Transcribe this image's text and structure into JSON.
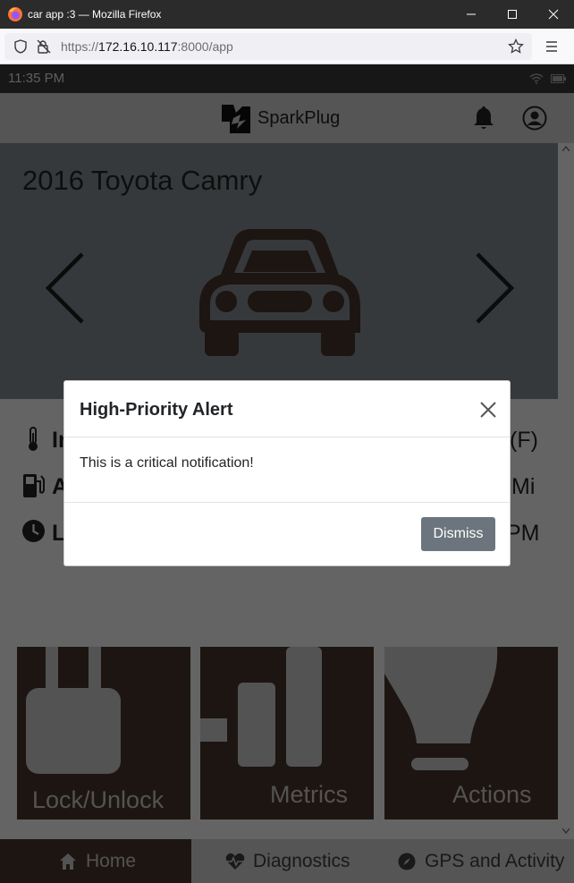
{
  "browser": {
    "window_title": "car app :3 — Mozilla Firefox",
    "url_prefix": "https://",
    "url_host": "172.16.10.117",
    "url_rest": ":8000/app"
  },
  "device_status": {
    "time": "11:35 PM"
  },
  "header": {
    "brand": "SparkPlug"
  },
  "vehicle": {
    "name": "2016 Toyota Camry"
  },
  "info_rows": [
    {
      "icon": "thermometer-icon",
      "left": "In",
      "right": "(F)"
    },
    {
      "icon": "fuel-pump-icon",
      "left": "A",
      "right": "Mi"
    },
    {
      "icon": "clock-icon",
      "left": "L",
      "right": "PM"
    }
  ],
  "tiles": [
    {
      "label": "Lock/Unlock",
      "icon": "lock-icon"
    },
    {
      "label": "Metrics",
      "icon": "bar-chart-icon"
    },
    {
      "label": "Actions",
      "icon": "lightbulb-icon"
    }
  ],
  "bottom_nav": [
    {
      "label": "Home",
      "icon": "home-icon",
      "active": true
    },
    {
      "label": "Diagnostics",
      "icon": "heartbeat-icon",
      "active": false
    },
    {
      "label": "GPS and Activity",
      "icon": "compass-icon",
      "active": false
    }
  ],
  "modal": {
    "title": "High-Priority Alert",
    "body": "This is a critical notification!",
    "dismiss_label": "Dismiss"
  },
  "colors": {
    "brand_brown": "#3a2b22",
    "hero_bg": "#6b7278",
    "dismiss_bg": "#6c757d"
  }
}
